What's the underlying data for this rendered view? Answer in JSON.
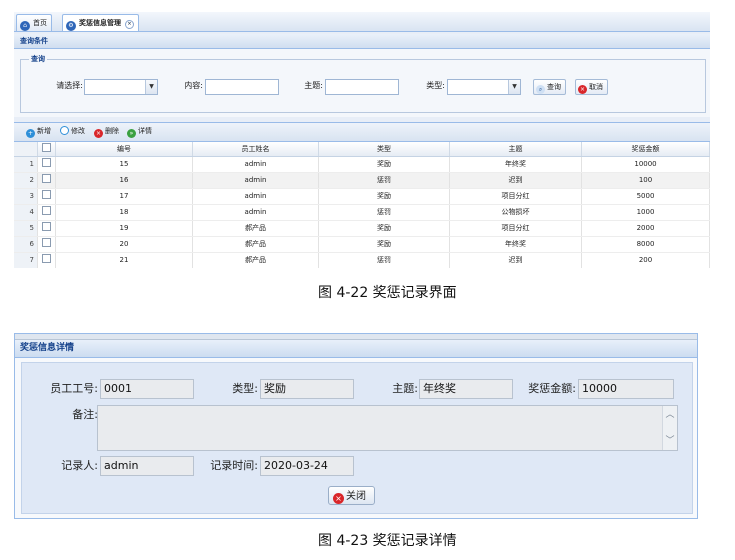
{
  "fig1": {
    "tabs": [
      {
        "label": "首页"
      },
      {
        "label": "奖惩信息管理",
        "close": "×"
      }
    ],
    "query_panel_title": "查询条件",
    "legend": "查询",
    "filters": {
      "select_label": "请选择:",
      "content_label": "内容:",
      "subject_label": "主题:",
      "type_label": "类型:"
    },
    "buttons": {
      "search": "查询",
      "cancel": "取消"
    },
    "toolbar": {
      "add": "新增",
      "edit": "修改",
      "delete": "删除",
      "detail": "详情"
    },
    "columns": [
      "编号",
      "员工姓名",
      "类型",
      "主题",
      "奖惩金额"
    ],
    "rows": [
      {
        "n": "1",
        "id": "15",
        "name": "admin",
        "type": "奖励",
        "subject": "年终奖",
        "amount": "10000"
      },
      {
        "n": "2",
        "id": "16",
        "name": "admin",
        "type": "惩罚",
        "subject": "迟到",
        "amount": "100"
      },
      {
        "n": "3",
        "id": "17",
        "name": "admin",
        "type": "奖励",
        "subject": "项目分红",
        "amount": "5000"
      },
      {
        "n": "4",
        "id": "18",
        "name": "admin",
        "type": "惩罚",
        "subject": "公物损坏",
        "amount": "1000"
      },
      {
        "n": "5",
        "id": "19",
        "name": "郝产品",
        "type": "奖励",
        "subject": "项目分红",
        "amount": "2000"
      },
      {
        "n": "6",
        "id": "20",
        "name": "郝产品",
        "type": "奖励",
        "subject": "年终奖",
        "amount": "8000"
      },
      {
        "n": "7",
        "id": "21",
        "name": "郝产品",
        "type": "惩罚",
        "subject": "迟到",
        "amount": "200"
      }
    ],
    "caption": "图 4-22  奖惩记录界面"
  },
  "fig2": {
    "title": "奖惩信息详情",
    "fields": {
      "emp_no_label": "员工工号:",
      "emp_no": "0001",
      "type_label": "类型:",
      "type": "奖励",
      "subject_label": "主题:",
      "subject": "年终奖",
      "amount_label": "奖惩金额:",
      "amount": "10000",
      "remark_label": "备注:",
      "recorder_label": "记录人:",
      "recorder": "admin",
      "time_label": "记录时间:",
      "time": "2020-03-24"
    },
    "close_label": "关闭",
    "caption": "图  4-23  奖惩记录详情"
  },
  "colors": {
    "accent": "#15428b",
    "border": "#99bbe8",
    "danger": "#d9262a",
    "add": "#2e8fd8",
    "detail": "#3aa040"
  }
}
